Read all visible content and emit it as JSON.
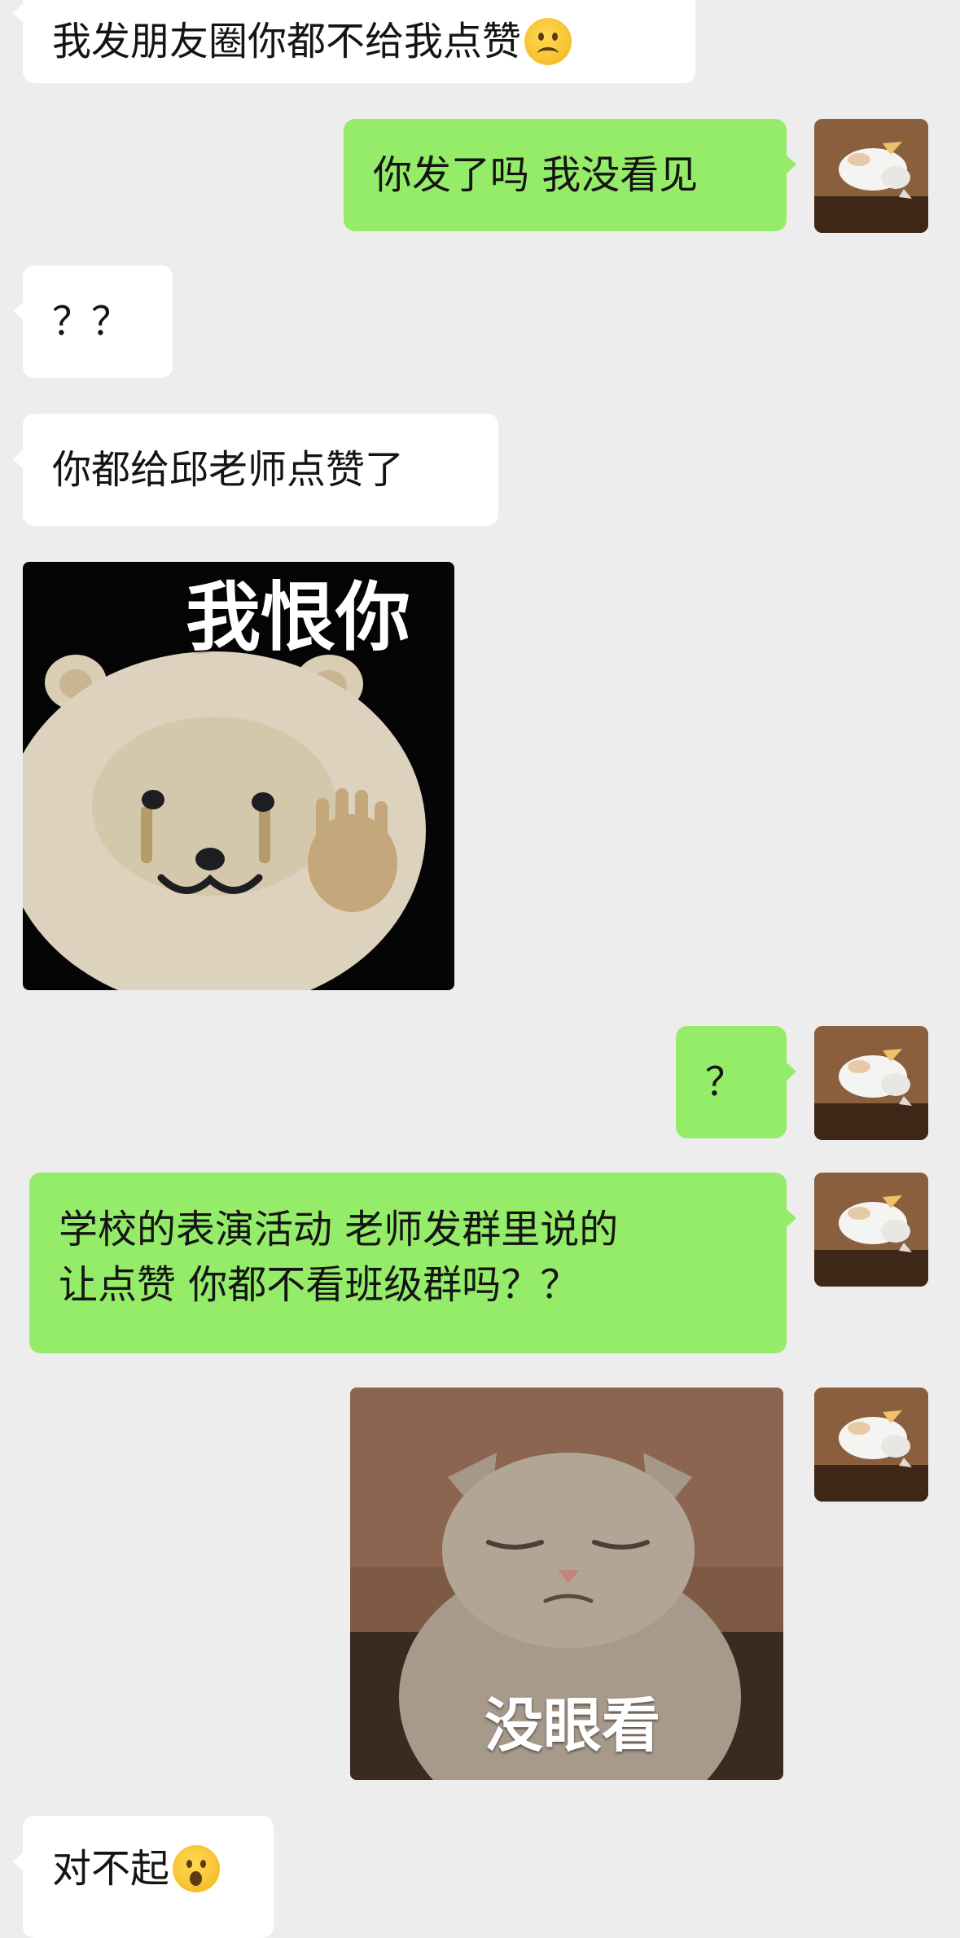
{
  "messages": [
    {
      "side": "in",
      "text": "我发朋友圈你都不给我点赞",
      "emoji": "frowning-face"
    },
    {
      "side": "out",
      "text": "你发了吗 我没看见"
    },
    {
      "side": "in",
      "text": "？？"
    },
    {
      "side": "in",
      "text": "你都给邱老师点赞了"
    },
    {
      "side": "in",
      "sticker": "bear",
      "caption": "我恨你"
    },
    {
      "side": "out",
      "text": "？"
    },
    {
      "side": "out",
      "lines": [
        "学校的表演活动 老师发群里说的",
        "让点赞 你都不看班级群吗？？"
      ]
    },
    {
      "side": "out",
      "sticker": "cat",
      "caption": "没眼看"
    },
    {
      "side": "in",
      "text": "对不起",
      "emoji": "face-with-open-mouth"
    }
  ],
  "colors": {
    "background": "#ededed",
    "incoming_bubble": "#ffffff",
    "outgoing_bubble": "#95ec69"
  }
}
